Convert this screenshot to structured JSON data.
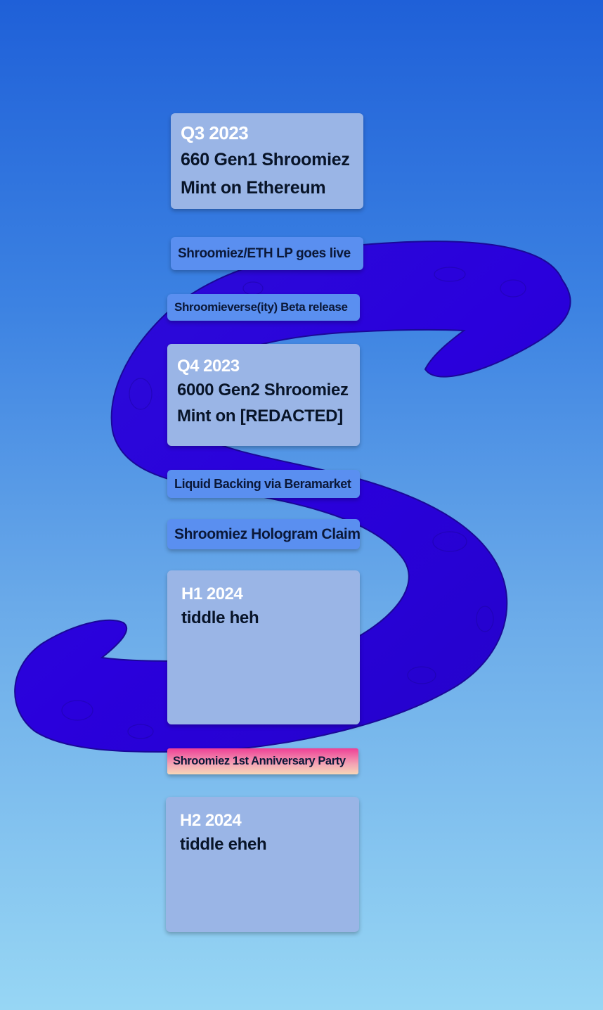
{
  "colors": {
    "background_top": "#1f60d8",
    "background_bottom": "#97d6f4",
    "serpent": "#2a0ad8",
    "card_big": "#9ab5e6",
    "card_small": "#5a8ff0",
    "card_anniversary": "#ee3f96"
  },
  "decoration": {
    "serpent_icon": "s-serpent-icon"
  },
  "roadmap": {
    "q3_2023": {
      "period": "Q3 2023",
      "line1": "660 Gen1 Shroomiez",
      "line2": "Mint on Ethereum"
    },
    "lp_live": "Shroomiez/ETH LP goes live",
    "beta_release": "Shroomieverse(ity) Beta release",
    "q4_2023": {
      "period": "Q4 2023",
      "line1": "6000 Gen2 Shroomiez",
      "line2": "Mint on [REDACTED]"
    },
    "liquid_backing": "Liquid Backing via Beramarket",
    "hologram_claim": "Shroomiez Hologram Claim",
    "h1_2024": {
      "period": "H1 2024",
      "line1": "tiddle heh"
    },
    "anniversary": "Shroomiez 1st Anniversary Party",
    "h2_2024": {
      "period": "H2 2024",
      "line1": "tiddle eheh"
    }
  }
}
